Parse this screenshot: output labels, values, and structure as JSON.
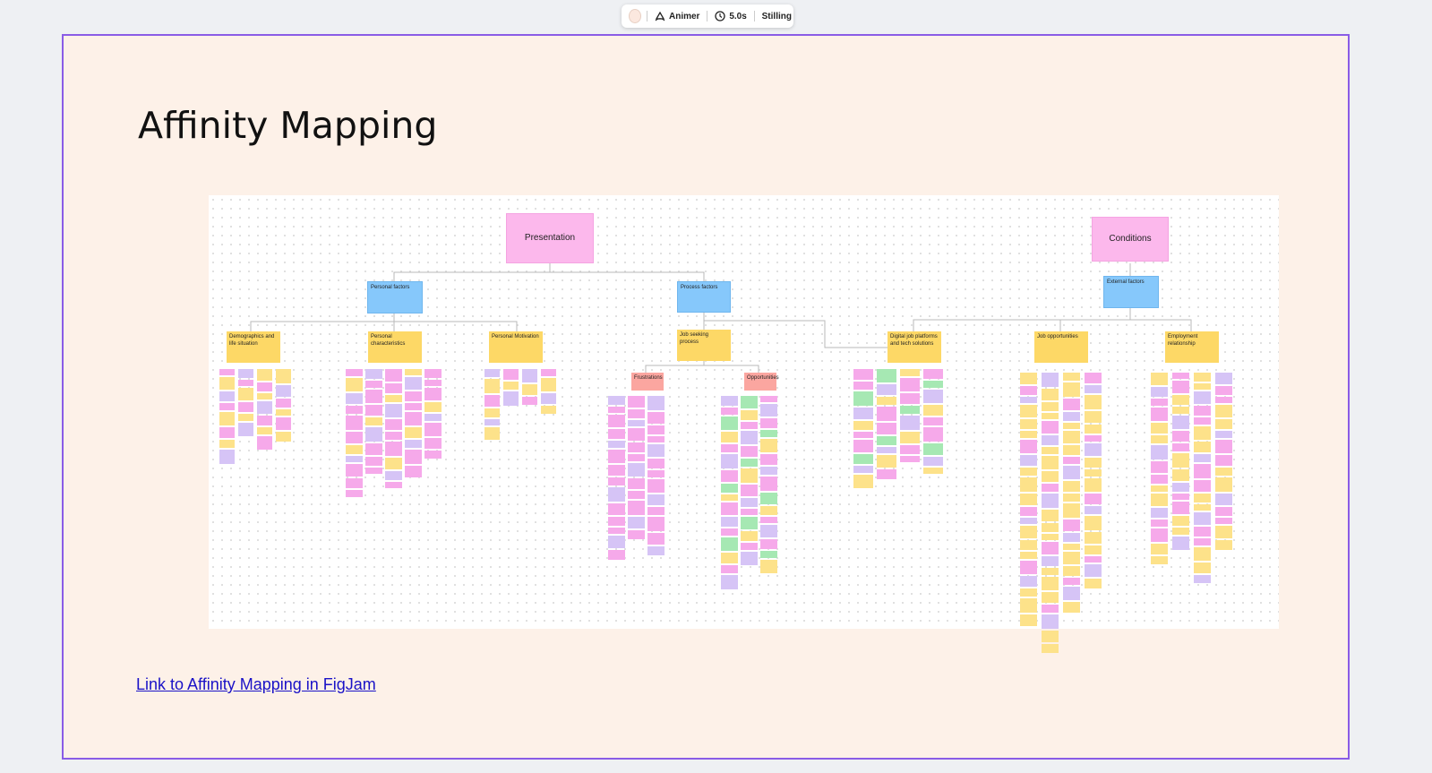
{
  "toolbar": {
    "color_swatch": "#fbe8df",
    "animate_icon": "animate-icon",
    "animate_label": "Animer",
    "timer_icon": "clock-icon",
    "duration_label": "5.0s",
    "transition_label": "Stilling"
  },
  "frame": {
    "title": "Affinity Mapping",
    "link_text": "Link to Affinity Mapping in FigJam "
  },
  "board": {
    "roots": [
      "Presentation",
      "Conditions"
    ],
    "categories": [
      "Personal factors",
      "Process factors",
      "External  factors"
    ],
    "subcategories": [
      "Demographics and life situation",
      "Personal characteristics",
      "Personal Motivation",
      "Job seeking process",
      "Digital job platforms and tech solutions",
      "Job opportunities",
      "Employment relationship"
    ],
    "process_groups": [
      "Frustrations",
      "Opportunities"
    ]
  },
  "colors": {
    "frame_border": "#8a5ce6",
    "frame_bg": "#fdf1e8",
    "root_pink": "#fcb8ec",
    "category_blue": "#86c8fb",
    "sub_yellow": "#fdd866",
    "group_red": "#fba6a0",
    "note_pink": "#f6a9ea",
    "note_yellow": "#fde28a",
    "note_purple": "#d6c4f6",
    "note_green": "#a6e8b3",
    "link": "#1a12c7"
  }
}
